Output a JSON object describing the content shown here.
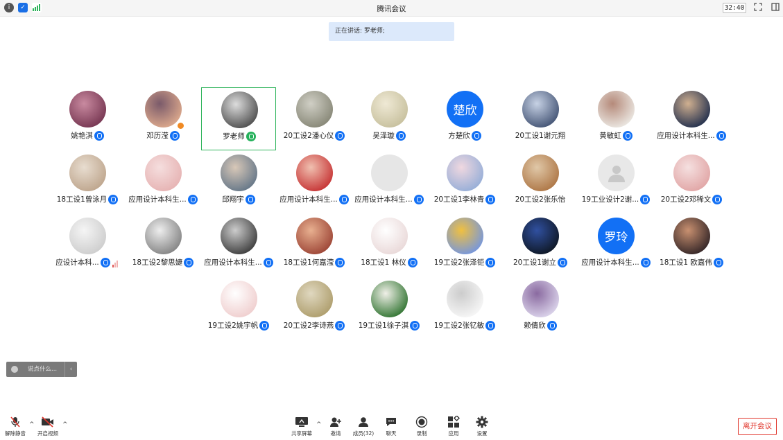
{
  "window": {
    "title": "腾讯会议",
    "timer": "32:40"
  },
  "speaking": "正在讲话: 罗老师;",
  "participants": [
    {
      "name": "姚艳淇",
      "mic": "on"
    },
    {
      "name": "邓历滢",
      "mic": "on",
      "host_badge": true
    },
    {
      "name": "罗老师",
      "mic": "speaking",
      "active": true
    },
    {
      "name": "20工设2潘心仪",
      "mic": "on"
    },
    {
      "name": "吴泽璇",
      "mic": "on"
    },
    {
      "name": "方楚欣",
      "mic": "on",
      "avatar_text": "楚欣"
    },
    {
      "name": "20工设1谢元翔",
      "mic": "none"
    },
    {
      "name": "黄敏虹",
      "mic": "on"
    },
    {
      "name": "应用设计本科生...",
      "mic": "on"
    },
    {
      "name": "18工设1曾泳月",
      "mic": "on"
    },
    {
      "name": "应用设计本科生...",
      "mic": "on"
    },
    {
      "name": "邱翔宇",
      "mic": "on"
    },
    {
      "name": "应用设计本科生...",
      "mic": "on"
    },
    {
      "name": "应用设计本科生...",
      "mic": "on"
    },
    {
      "name": "20工设1李林青",
      "mic": "on"
    },
    {
      "name": "20工设2张乐怡",
      "mic": "none"
    },
    {
      "name": "19工业设计2谢...",
      "mic": "on"
    },
    {
      "name": "20工设2邓稀文",
      "mic": "on"
    },
    {
      "name": "应设计本科...",
      "mic": "on",
      "signal": true
    },
    {
      "name": "18工设2黎思婕",
      "mic": "on"
    },
    {
      "name": "应用设计本科生...",
      "mic": "on"
    },
    {
      "name": "18工设1何嘉滢",
      "mic": "on"
    },
    {
      "name": "18工设1 林仪",
      "mic": "on"
    },
    {
      "name": "19工设2张泽钜",
      "mic": "on"
    },
    {
      "name": "20工设1谢立",
      "mic": "on"
    },
    {
      "name": "应用设计本科生...",
      "mic": "on",
      "avatar_text": "罗玲"
    },
    {
      "name": "18工设1 欧嘉伟",
      "mic": "on"
    },
    {
      "name": "19工设2姚宇帆",
      "mic": "on"
    },
    {
      "name": "20工设2李诗燕",
      "mic": "on"
    },
    {
      "name": "19工设1徐子淇",
      "mic": "on"
    },
    {
      "name": "19工设2张钇敏",
      "mic": "on"
    },
    {
      "name": "赖倩欣",
      "mic": "on"
    }
  ],
  "chat": {
    "placeholder": "说点什么..."
  },
  "toolbar": {
    "unmute": "解除静音",
    "video": "开启视频",
    "share": "共享屏幕",
    "invite": "邀请",
    "members": "成员(32)",
    "chat": "聊天",
    "record": "录制",
    "apps": "应用",
    "settings": "设置",
    "leave": "离开会议"
  },
  "colors": {
    "accent": "#1270f5",
    "speaking_green": "#2db35a",
    "leave_red": "#e0352b"
  }
}
